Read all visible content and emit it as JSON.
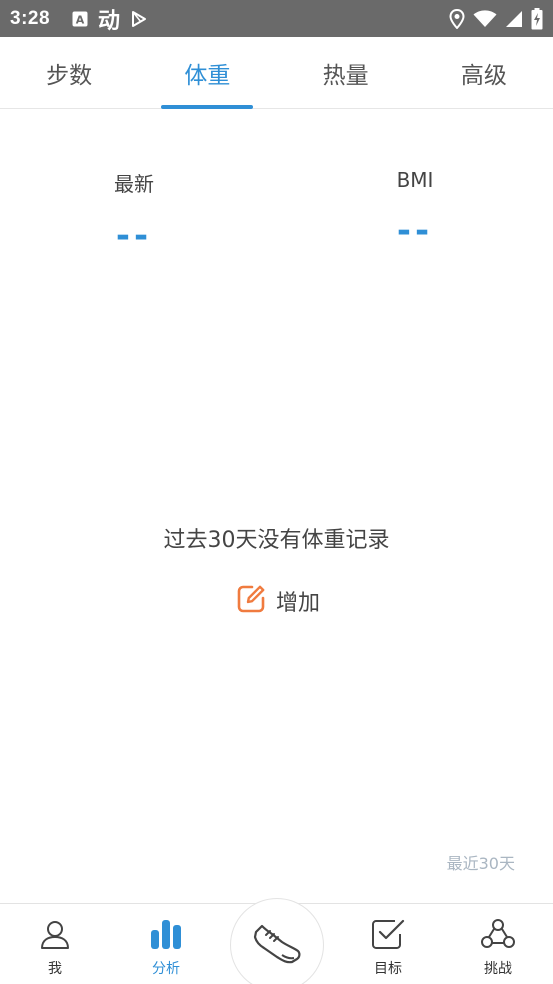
{
  "status_bar": {
    "time": "3:28",
    "left_icons": [
      "a-box-icon",
      "app-logo-icon",
      "play-store-icon"
    ],
    "right_icons": [
      "location-icon",
      "wifi-icon",
      "signal-icon",
      "battery-charging-icon"
    ],
    "logo_text": "动"
  },
  "tabs": [
    {
      "label": "步数",
      "active": false
    },
    {
      "label": "体重",
      "active": true
    },
    {
      "label": "热量",
      "active": false
    },
    {
      "label": "高级",
      "active": false
    }
  ],
  "metrics": {
    "latest": {
      "label": "最新",
      "value": "--"
    },
    "bmi": {
      "label": "BMI",
      "value": "--"
    }
  },
  "empty_state": {
    "message": "过去30天没有体重记录",
    "add_label": "增加"
  },
  "range_label": "最近30天",
  "bottom_nav": {
    "me": "我",
    "analysis": "分析",
    "goal": "目标",
    "challenge": "挑战"
  },
  "colors": {
    "accent": "#2f8fd6",
    "add_icon": "#f07b3f",
    "status_bar": "#6a6a6a"
  }
}
